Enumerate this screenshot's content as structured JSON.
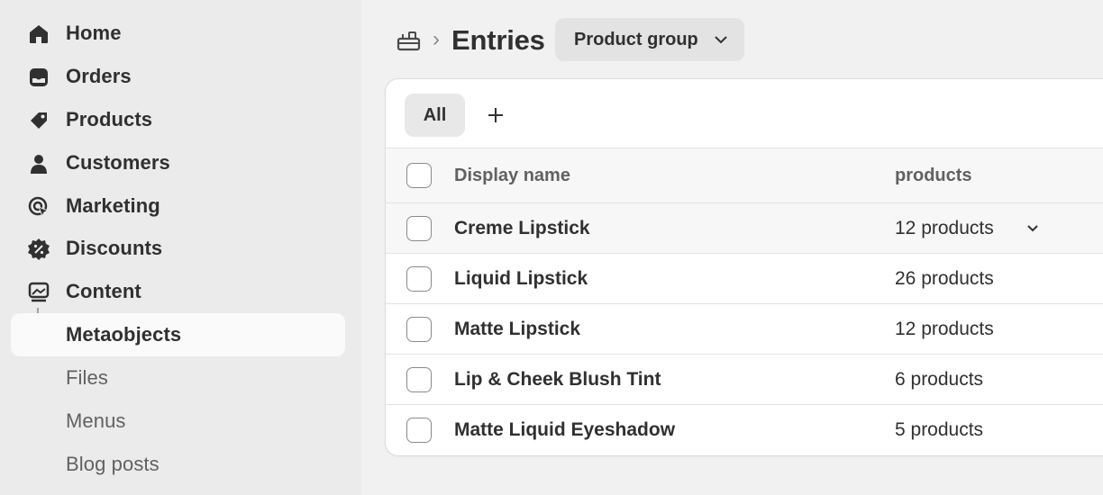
{
  "sidebar": {
    "items": [
      {
        "label": "Home",
        "icon": "home-icon"
      },
      {
        "label": "Orders",
        "icon": "inbox-icon"
      },
      {
        "label": "Products",
        "icon": "tag-icon"
      },
      {
        "label": "Customers",
        "icon": "person-icon"
      },
      {
        "label": "Marketing",
        "icon": "target-icon"
      },
      {
        "label": "Discounts",
        "icon": "discount-icon"
      },
      {
        "label": "Content",
        "icon": "image-icon"
      }
    ],
    "sub_items": [
      {
        "label": "Metaobjects",
        "active": true
      },
      {
        "label": "Files"
      },
      {
        "label": "Menus"
      },
      {
        "label": "Blog posts"
      }
    ]
  },
  "header": {
    "breadcrumb_icon": "metaobject-icon",
    "separator": "›",
    "title": "Entries",
    "group_button_label": "Product group"
  },
  "tabs": {
    "all_label": "All",
    "add_label": "+"
  },
  "table": {
    "columns": [
      "Display name",
      "products"
    ],
    "rows": [
      {
        "name": "Creme Lipstick",
        "count": "12 products"
      },
      {
        "name": "Liquid Lipstick",
        "count": "26 products"
      },
      {
        "name": "Matte Lipstick",
        "count": "12 products"
      },
      {
        "name": "Lip & Cheek Blush Tint",
        "count": "6 products"
      },
      {
        "name": "Matte Liquid Eyeshadow",
        "count": "5 products"
      }
    ]
  },
  "colors": {
    "sidebar_bg": "#ebebeb",
    "main_bg": "#f1f1f1",
    "text": "#303030",
    "muted": "#616161"
  }
}
